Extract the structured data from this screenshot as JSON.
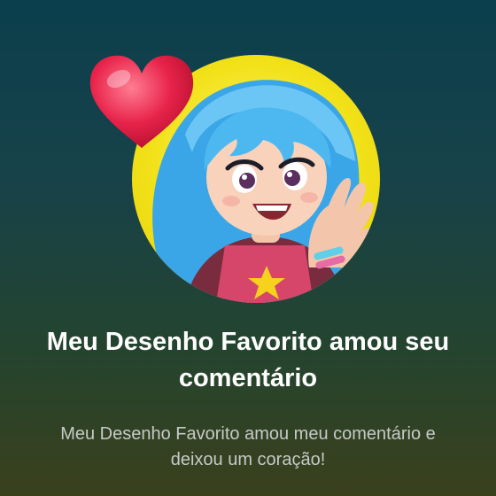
{
  "notification": {
    "title": "Meu Desenho Favorito amou seu comentário",
    "message": "Meu Desenho Favorito amou meu comentário e deixou um coração!",
    "avatar_icon": "cartoon-girl-avatar",
    "reaction_icon": "heart-icon"
  },
  "colors": {
    "background_top": "#0b3f4d",
    "background_bottom": "#3a401c",
    "avatar_ring": "#f2e21a",
    "heart": "#e8234a",
    "title_text": "#ffffff",
    "message_text": "#c7c9c8"
  }
}
